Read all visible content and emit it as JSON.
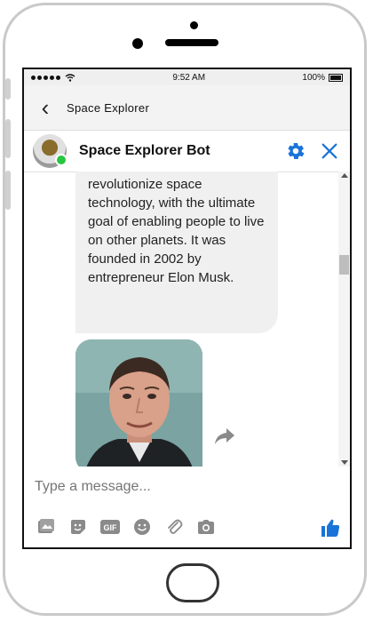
{
  "statusbar": {
    "time": "9:52 AM",
    "battery": "100%"
  },
  "nav": {
    "title": "Space Explorer"
  },
  "chat_header": {
    "bot_name": "Space Explorer Bot"
  },
  "messages": {
    "bot_text": "revolutionize space technology, with the ultimate goal of enabling people to live on other planets. It was founded in 2002 by entrepreneur Elon Musk."
  },
  "composer": {
    "placeholder": "Type a message..."
  },
  "colors": {
    "accent": "#1a73d9",
    "online": "#29c640"
  }
}
